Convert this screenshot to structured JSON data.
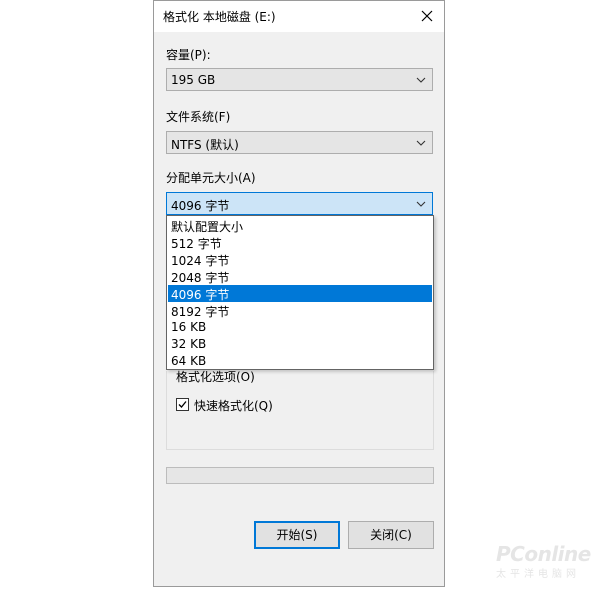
{
  "window": {
    "title": "格式化 本地磁盘 (E:)"
  },
  "capacity": {
    "label": "容量(P):",
    "value": "195 GB"
  },
  "filesystem": {
    "label": "文件系统(F)",
    "value": "NTFS (默认)"
  },
  "allocation": {
    "label": "分配单元大小(A)",
    "value": "4096 字节",
    "options": [
      "默认配置大小",
      "512 字节",
      "1024 字节",
      "2048 字节",
      "4096 字节",
      "8192 字节",
      "16 KB",
      "32 KB",
      "64 KB"
    ],
    "selected_index": 4
  },
  "format_options": {
    "label": "格式化选项(O)",
    "quick_format_label": "快速格式化(Q)",
    "quick_format_checked": true
  },
  "progress": {
    "value": 0
  },
  "buttons": {
    "start_label": "开始(S)",
    "close_label": "关闭(C)"
  },
  "watermark": {
    "brand": "PConline",
    "sub": "太平洋电脑网"
  },
  "colors": {
    "accent": "#0078d7",
    "dialog_bg": "#f0f0f0"
  }
}
